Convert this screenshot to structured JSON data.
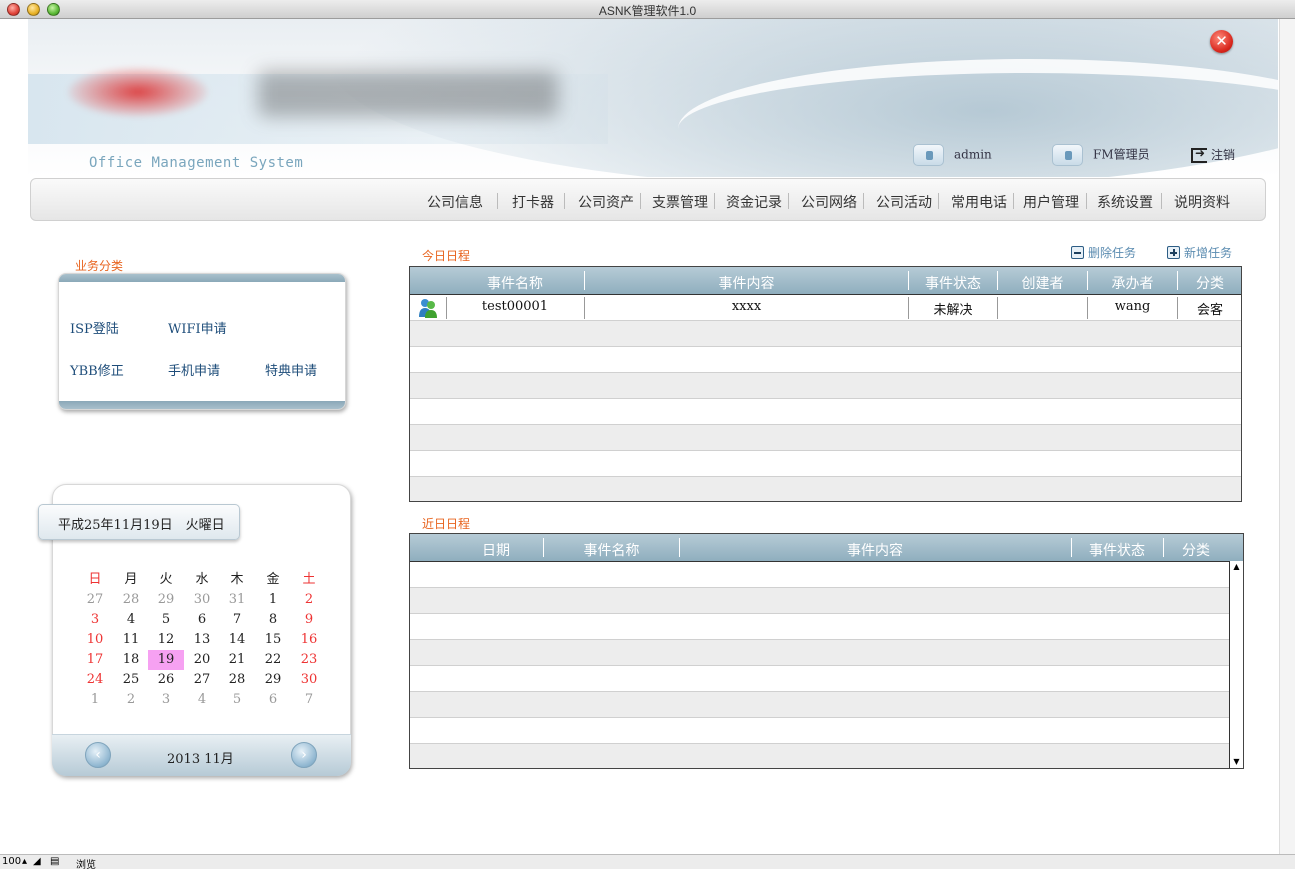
{
  "window": {
    "title": "ASNK管理软件1.0"
  },
  "banner": {
    "subtitle": "Office Management System"
  },
  "userbar": {
    "admin": "admin",
    "role": "FM管理员",
    "logout": "注销"
  },
  "nav": [
    "公司信息",
    "打卡器",
    "公司资产",
    "支票管理",
    "资金记录",
    "公司网络",
    "公司活动",
    "常用电话",
    "用户管理",
    "系统设置",
    "说明资料"
  ],
  "categories": {
    "title": "业务分类",
    "items": [
      "ISP登陆",
      "WIFI申请",
      "YBB修正",
      "手机申请",
      "特典申请"
    ]
  },
  "calendar": {
    "date_label": "平成25年11月19日　火曜日",
    "weekdays": [
      "日",
      "月",
      "火",
      "水",
      "木",
      "金",
      "土"
    ],
    "weeks": [
      [
        "27",
        "28",
        "29",
        "30",
        "31",
        "1",
        "2"
      ],
      [
        "3",
        "4",
        "5",
        "6",
        "7",
        "8",
        "9"
      ],
      [
        "10",
        "11",
        "12",
        "13",
        "14",
        "15",
        "16"
      ],
      [
        "17",
        "18",
        "19",
        "20",
        "21",
        "22",
        "23"
      ],
      [
        "24",
        "25",
        "26",
        "27",
        "28",
        "29",
        "30"
      ],
      [
        "1",
        "2",
        "3",
        "4",
        "5",
        "6",
        "7"
      ]
    ],
    "selected_day": "19",
    "month_label": "2013 11月",
    "prev_label": "‹",
    "next_label": "›"
  },
  "today": {
    "title": "今日日程",
    "delete_label": "删除任务",
    "add_label": "新增任务",
    "columns": [
      "事件名称",
      "事件内容",
      "事件状态",
      "创建者",
      "承办者",
      "分类"
    ],
    "rows": [
      {
        "name": "test00001",
        "content": "xxxx",
        "status": "未解决",
        "creator": "",
        "assignee": "wang",
        "category": "会客"
      }
    ]
  },
  "recent": {
    "title": "近日日程",
    "columns": [
      "日期",
      "事件名称",
      "事件内容",
      "事件状态",
      "分类"
    ]
  },
  "status_bar": {
    "zoom": "100",
    "mode": "浏览"
  },
  "colors": {
    "accent_orange": "#e8641f",
    "header_blue": "#8faebe",
    "link_blue": "#1e4d7a",
    "today_highlight": "#f6a1f2"
  }
}
